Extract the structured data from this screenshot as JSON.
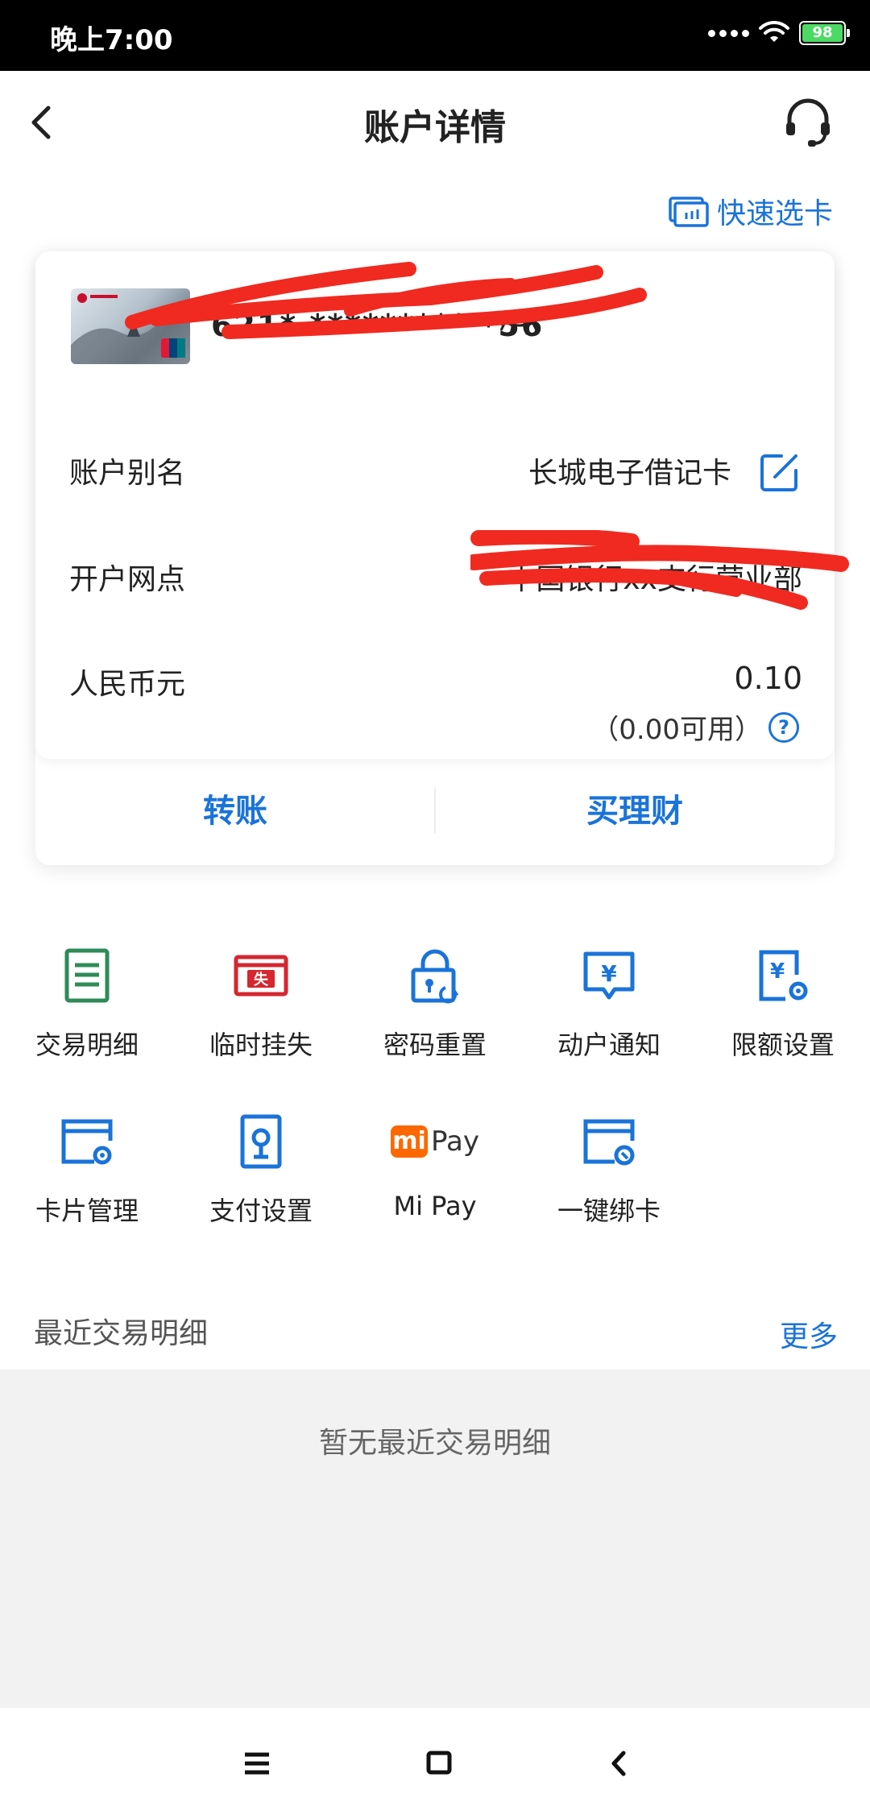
{
  "status_bar": {
    "time": "晚上7:00",
    "battery": "98",
    "wifi_icon": "wifi-icon",
    "signal_icon": "signal-dots-icon"
  },
  "header": {
    "title": "账户详情",
    "back_icon": "chevron-left-icon",
    "support_icon": "headset-icon"
  },
  "quick_select": {
    "label": "快速选卡",
    "icon": "card-switch-icon"
  },
  "card": {
    "number_masked": "621* ********* *56",
    "alias_label": "账户别名",
    "alias_value": "长城电子借记卡",
    "branch_label": "开户网点",
    "branch_value": "中国银行xx支行营业部",
    "currency_label": "人民币元",
    "balance": "0.10",
    "available": "（0.00可用）",
    "help_icon_glyph": "?"
  },
  "actions": {
    "transfer": "转账",
    "wealth": "买理财"
  },
  "functions": [
    {
      "label": "交易明细",
      "icon": "transaction-list-icon"
    },
    {
      "label": "临时挂失",
      "icon": "report-loss-icon",
      "glyph": "失"
    },
    {
      "label": "密码重置",
      "icon": "password-reset-icon"
    },
    {
      "label": "动户通知",
      "icon": "account-notice-icon",
      "glyph": "¥"
    },
    {
      "label": "限额设置",
      "icon": "limit-settings-icon",
      "glyph": "¥"
    },
    {
      "label": "卡片管理",
      "icon": "card-manage-icon"
    },
    {
      "label": "支付设置",
      "icon": "payment-settings-icon"
    },
    {
      "label": "Mi Pay",
      "icon": "mipay-logo",
      "logo_mi": "mi",
      "logo_pay": "Pay"
    },
    {
      "label": "一键绑卡",
      "icon": "bind-card-icon"
    }
  ],
  "recent": {
    "title": "最近交易明细",
    "more": "更多",
    "empty": "暂无最近交易明细"
  },
  "colors": {
    "accent": "#1a73d9",
    "green": "#2e8b57",
    "red": "#d6262f",
    "orange": "#ff6700",
    "panel": "#f2f2f2"
  }
}
